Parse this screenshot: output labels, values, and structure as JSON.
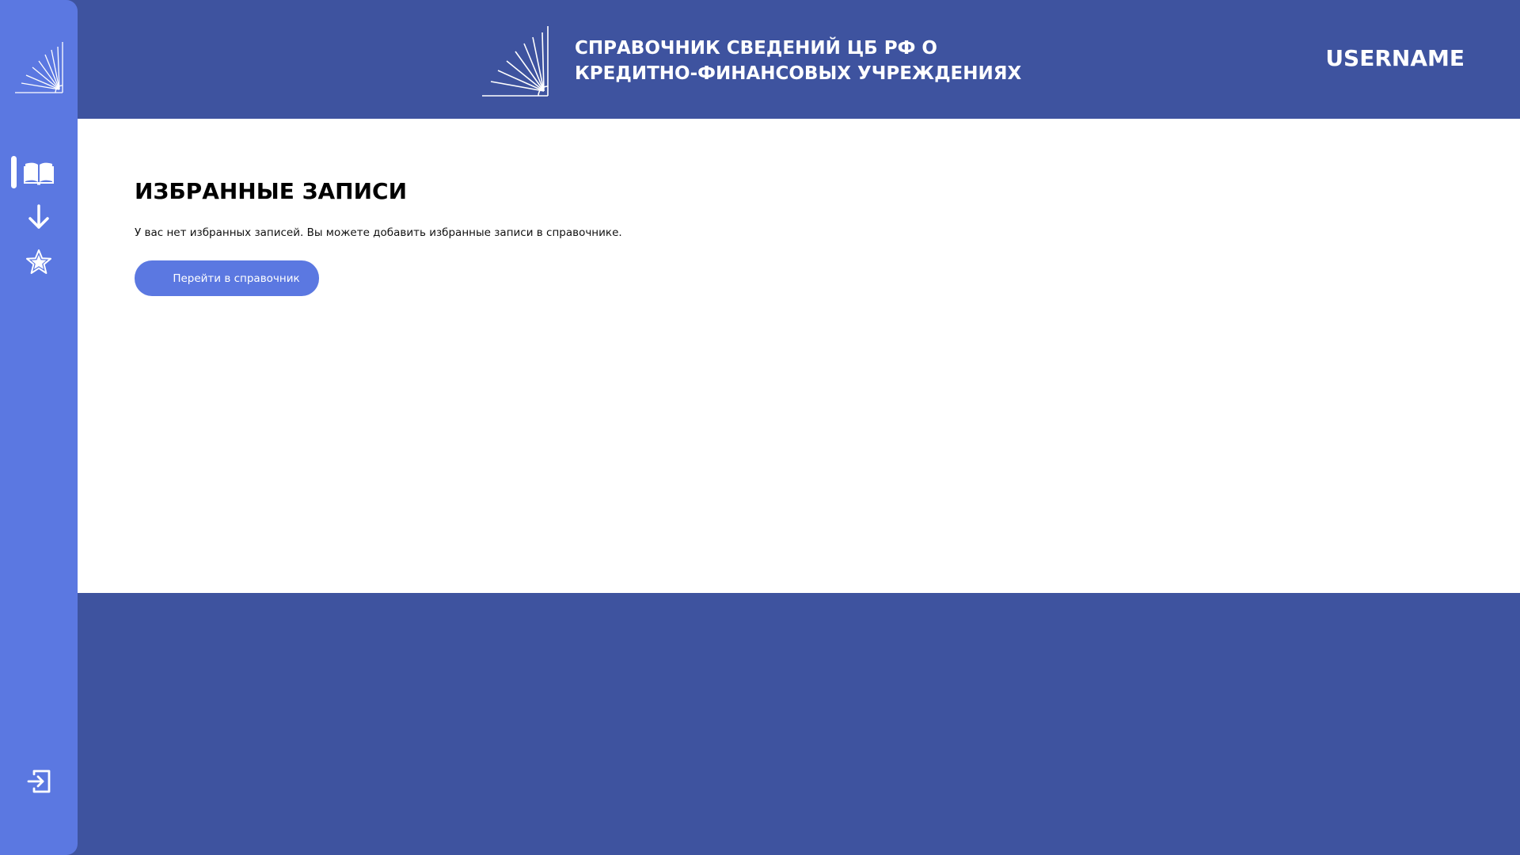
{
  "header": {
    "title": "СПРАВОЧНИК СВЕДЕНИЙ ЦБ РФ О КРЕДИТНО-ФИНАНСОВЫХ УЧРЕЖДЕНИЯХ",
    "username": "USERNAME"
  },
  "sidebar": {
    "items": [
      {
        "name": "directory",
        "icon": "book-icon",
        "active": true
      },
      {
        "name": "downloads",
        "icon": "arrow-down-icon",
        "active": false
      },
      {
        "name": "favorites",
        "icon": "star-icon",
        "active": false
      }
    ],
    "logout_icon": "logout-icon"
  },
  "main": {
    "title": "ИЗБРАННЫЕ ЗАПИСИ",
    "empty_message": "У вас нет избранных записей. Вы можете добавить избранные записи в справочнике.",
    "button_label": "Перейти в справочник"
  },
  "colors": {
    "dark_blue": "#3e539f",
    "accent_blue": "#5b78e1",
    "white": "#ffffff"
  }
}
